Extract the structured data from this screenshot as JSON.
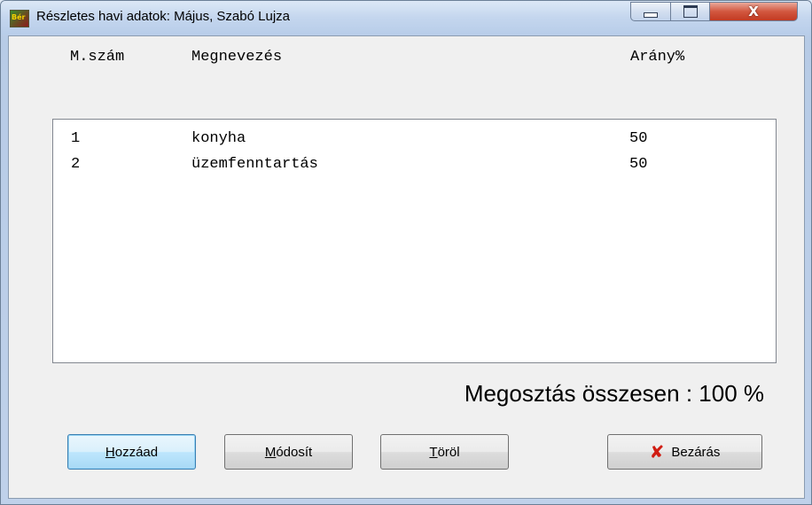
{
  "window": {
    "title": "Részletes havi adatok: Május, Szabó Lujza",
    "app_icon_text": "Bér",
    "close_glyph": "X"
  },
  "list": {
    "headers": {
      "id": "M.szám",
      "name": "Megnevezés",
      "ratio": "Arány%"
    },
    "rows": [
      {
        "id": "1",
        "name": "konyha",
        "ratio": "50"
      },
      {
        "id": "2",
        "name": "üzemfenntartás",
        "ratio": "50"
      }
    ]
  },
  "summary": {
    "text": "Megosztás összesen : 100 %"
  },
  "buttons": {
    "add": {
      "accel": "H",
      "rest": "ozzáad"
    },
    "modify": {
      "accel": "M",
      "rest": "ódosít"
    },
    "delete": {
      "accel": "T",
      "rest": "öröl"
    },
    "close": {
      "icon": "x-icon",
      "label": "Bezárás"
    }
  },
  "colors": {
    "close_icon": "#d01c12",
    "titlebar_close": "#c23a22"
  }
}
